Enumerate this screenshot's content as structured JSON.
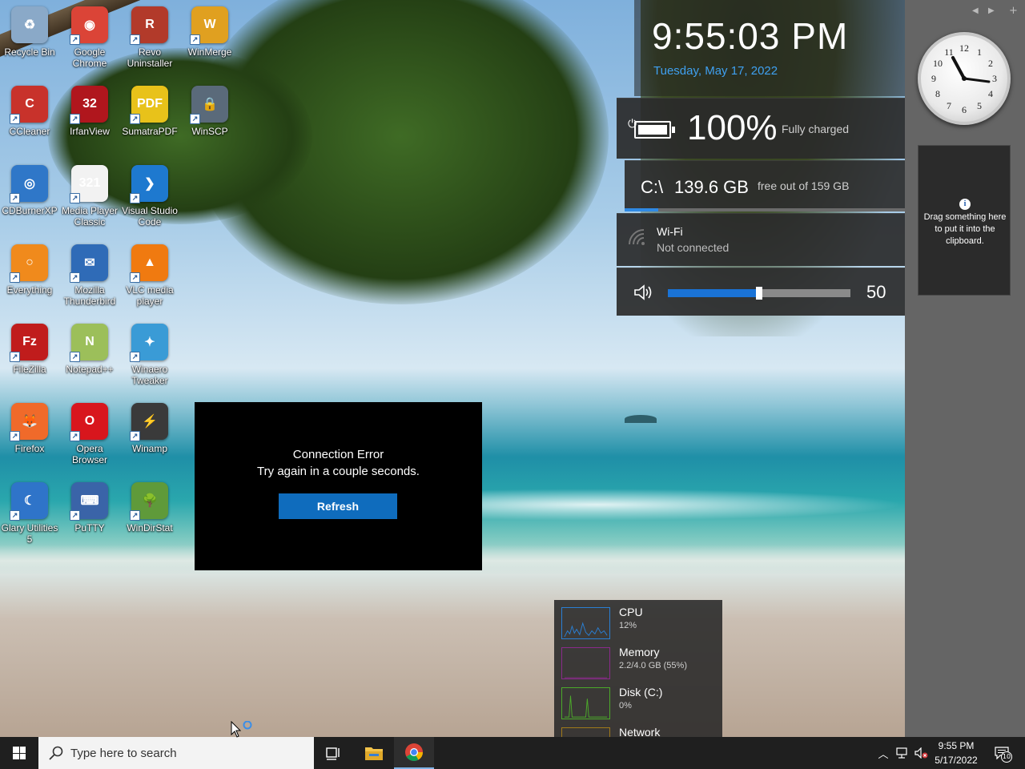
{
  "desktop_icons": [
    {
      "label": "Recycle Bin",
      "icon": "recycle-bin-icon",
      "color": "#8aa9c8",
      "glyph": "♻"
    },
    {
      "label": "Google Chrome",
      "icon": "chrome-icon",
      "color": "#db4437",
      "glyph": "◉"
    },
    {
      "label": "Revo Uninstaller",
      "icon": "revo-uninstaller-icon",
      "color": "#b23a2a",
      "glyph": "R"
    },
    {
      "label": "WinMerge",
      "icon": "winmerge-icon",
      "color": "#e0a020",
      "glyph": "W"
    },
    {
      "label": "CCleaner",
      "icon": "ccleaner-icon",
      "color": "#c8322b",
      "glyph": "C"
    },
    {
      "label": "IrfanView",
      "icon": "irfanview-icon",
      "color": "#b0161d",
      "glyph": "32"
    },
    {
      "label": "SumatraPDF",
      "icon": "sumatrapdf-icon",
      "color": "#e8c21a",
      "glyph": "PDF"
    },
    {
      "label": "WinSCP",
      "icon": "winscp-icon",
      "color": "#5a6a7a",
      "glyph": "🔒"
    },
    {
      "label": "CDBurnerXP",
      "icon": "cdburnerxp-icon",
      "color": "#2f77c8",
      "glyph": "◎"
    },
    {
      "label": "Media Player Classic",
      "icon": "media-player-classic-icon",
      "color": "#f2f2f2",
      "glyph": "321"
    },
    {
      "label": "Visual Studio Code",
      "icon": "vscode-icon",
      "color": "#1e79cf",
      "glyph": "❯"
    },
    {
      "label": "Everything",
      "icon": "everything-icon",
      "color": "#f08a1c",
      "glyph": "○"
    },
    {
      "label": "Mozilla Thunderbird",
      "icon": "thunderbird-icon",
      "color": "#2f6bb7",
      "glyph": "✉"
    },
    {
      "label": "VLC media player",
      "icon": "vlc-icon",
      "color": "#f07a10",
      "glyph": "▲"
    },
    {
      "label": "FileZilla",
      "icon": "filezilla-icon",
      "color": "#c01c1c",
      "glyph": "Fz"
    },
    {
      "label": "Notepad++",
      "icon": "notepadpp-icon",
      "color": "#9cbf5a",
      "glyph": "N"
    },
    {
      "label": "Winaero Tweaker",
      "icon": "winaero-tweaker-icon",
      "color": "#3a9bd6",
      "glyph": "✦"
    },
    {
      "label": "Firefox",
      "icon": "firefox-icon",
      "color": "#f06a2a",
      "glyph": "🦊"
    },
    {
      "label": "Opera Browser",
      "icon": "opera-icon",
      "color": "#d8161d",
      "glyph": "O"
    },
    {
      "label": "Winamp",
      "icon": "winamp-icon",
      "color": "#3a3a3a",
      "glyph": "⚡"
    },
    {
      "label": "Glary Utilities 5",
      "icon": "glary-utilities-icon",
      "color": "#2f74c9",
      "glyph": "☾"
    },
    {
      "label": "PuTTY",
      "icon": "putty-icon",
      "color": "#3a64a8",
      "glyph": "⌨"
    },
    {
      "label": "WinDirStat",
      "icon": "windirstat-icon",
      "color": "#5f9a3a",
      "glyph": "🌳"
    }
  ],
  "clock": {
    "time": "9:55:03 PM",
    "date": "Tuesday, May 17, 2022"
  },
  "battery": {
    "percent_label": "100%",
    "level": 1.0,
    "status": "Fully charged"
  },
  "disk": {
    "drive": "C:\\",
    "free": "139.6 GB",
    "total_text": "free out of 159 GB",
    "used_fraction": 0.12
  },
  "wifi": {
    "name": "Wi-Fi",
    "status": "Not connected"
  },
  "volume": {
    "value": 50,
    "label": "50"
  },
  "clipboard_gadget": {
    "info_glyph": "i",
    "text": "Drag something here to put it into the clipboard."
  },
  "dialog": {
    "title": "Connection Error",
    "message": "Try again in a couple seconds.",
    "button": "Refresh"
  },
  "perf": [
    {
      "name": "CPU",
      "value": "12%",
      "color": "#2a7fd4"
    },
    {
      "name": "Memory",
      "value": "2.2/4.0 GB (55%)",
      "color": "#8b2a8b"
    },
    {
      "name": "Disk (C:)",
      "value": "0%",
      "color": "#4caa2a"
    },
    {
      "name": "Network",
      "value": "",
      "color": "#a07a1a"
    }
  ],
  "taskbar": {
    "search_placeholder": "Type here to search",
    "clock_time": "9:55 PM",
    "clock_date": "5/17/2022",
    "notification_count": "10"
  }
}
